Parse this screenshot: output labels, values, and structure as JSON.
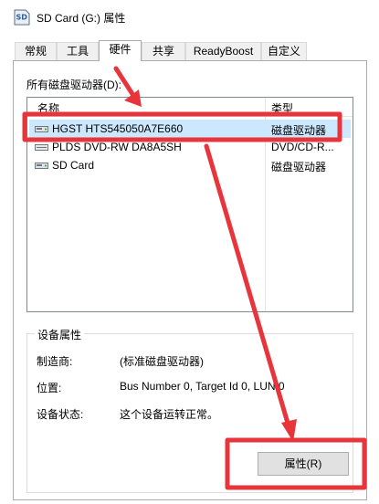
{
  "window": {
    "title": "SD Card (G:) 属性",
    "icon_name": "sd-card-icon",
    "icon_text": "SD"
  },
  "tabs": [
    {
      "label": "常规",
      "active": false
    },
    {
      "label": "工具",
      "active": false
    },
    {
      "label": "硬件",
      "active": true
    },
    {
      "label": "共享",
      "active": false
    },
    {
      "label": "ReadyBoost",
      "active": false
    },
    {
      "label": "自定义",
      "active": false
    }
  ],
  "hardware": {
    "drives_label": "所有磁盘驱动器(D):",
    "columns": {
      "name": "名称",
      "type": "类型"
    },
    "rows": [
      {
        "name": "HGST HTS545050A7E660",
        "type": "磁盘驱动器",
        "icon": "disk-drive-icon",
        "selected": true
      },
      {
        "name": "PLDS DVD-RW DA8A5SH",
        "type": "DVD/CD-R...",
        "icon": "dvd-drive-icon",
        "selected": false
      },
      {
        "name": "SD Card",
        "type": "磁盘驱动器",
        "icon": "disk-drive-icon",
        "selected": false
      }
    ],
    "properties_group": {
      "title": "设备属性",
      "manufacturer_label": "制造商:",
      "manufacturer_value": "(标准磁盘驱动器)",
      "location_label": "位置:",
      "location_value": "Bus Number 0, Target Id 0, LUN 0",
      "status_label": "设备状态:",
      "status_value": "这个设备运转正常。"
    },
    "properties_button": "属性(R)"
  },
  "colors": {
    "annotation_red": "#e8343b",
    "selection": "#cce8ff"
  }
}
